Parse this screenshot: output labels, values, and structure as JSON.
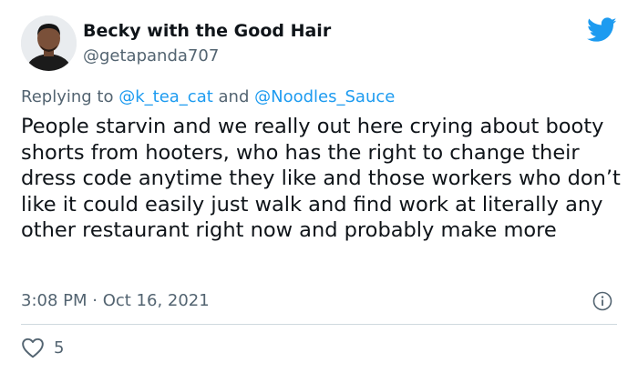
{
  "author": {
    "display_name": "Becky with the Good Hair",
    "handle": "@getapanda707"
  },
  "reply": {
    "prefix": "Replying to",
    "mention_1": "@k_tea_cat",
    "joiner": "and",
    "mention_2": "@Noodles_Sauce"
  },
  "tweet": {
    "text": "People starvin and we really out here crying about booty shorts from hooters, who has the right to change their dress code anytime they like and those workers who don’t like it could easily just walk and find work at literally any other restaurant right now and probably make more",
    "timestamp": "3:08 PM · Oct 16, 2021"
  },
  "stats": {
    "likes": "5"
  },
  "icons": {
    "brand": "twitter-bird-icon",
    "info": "info-icon",
    "like": "heart-icon"
  },
  "colors": {
    "accent": "#1d9bf0",
    "secondary_text": "#536471",
    "divider": "#cfd9de"
  }
}
